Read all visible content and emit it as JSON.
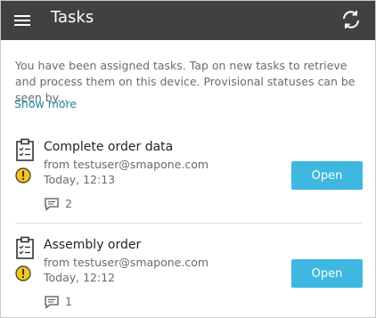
{
  "header": {
    "title": "Tasks",
    "menu_icon": "hamburger-menu-icon",
    "refresh_icon": "refresh-icon"
  },
  "intro": {
    "text": "You have been assigned tasks. Tap on new tasks to retrieve and process them on this device. Provisional statuses can be seen by...",
    "show_more": "Show more"
  },
  "tasks": [
    {
      "title": "Complete order data",
      "from": "from testuser@smapone.com",
      "date": "Today, 12:13",
      "comments": "2",
      "open_label": "Open",
      "status_icon": "warning-icon"
    },
    {
      "title": "Assembly order",
      "from": "from testuser@smapone.com",
      "date": "Today, 12:12",
      "comments": "1",
      "open_label": "Open",
      "status_icon": "warning-icon"
    }
  ],
  "colors": {
    "header_bg": "#414141",
    "accent_button": "#3eb8e0",
    "link": "#1a86a5",
    "warning": "#f5c518"
  }
}
